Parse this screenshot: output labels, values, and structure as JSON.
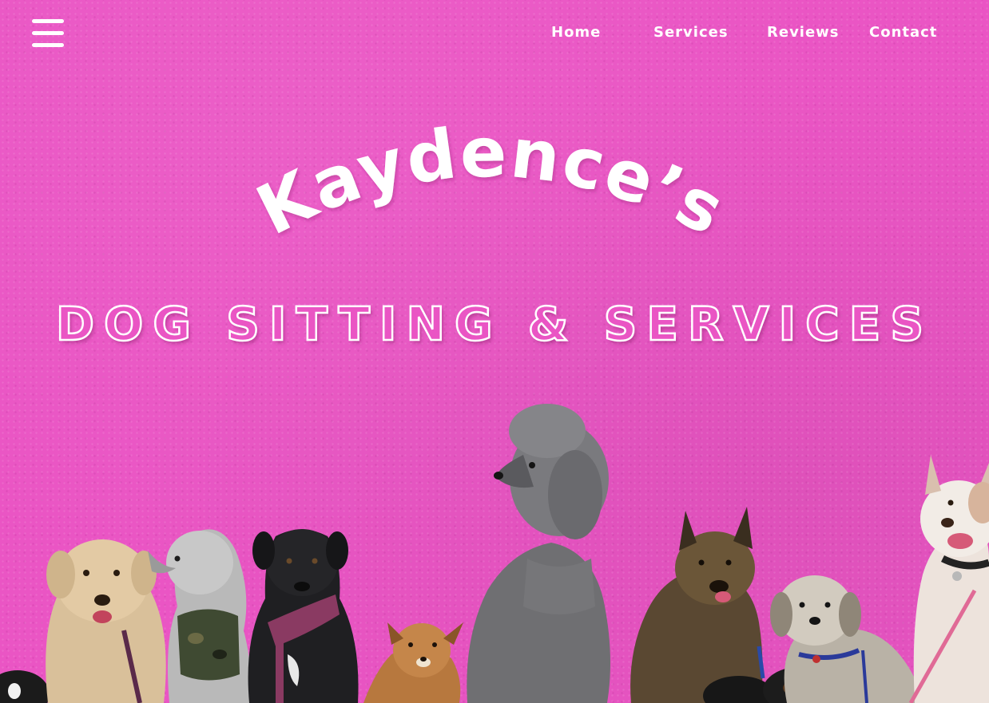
{
  "nav": {
    "menu_icon": "hamburger-menu-icon",
    "items": [
      {
        "label": "Home"
      },
      {
        "label": "Services"
      },
      {
        "label": "Reviews"
      },
      {
        "label": "Contact"
      }
    ]
  },
  "hero": {
    "title": "Kaydence’s",
    "subtitle": "DOG SITTING & SERVICES",
    "background_color": "#ea55c4",
    "text_color": "#ffffff"
  }
}
